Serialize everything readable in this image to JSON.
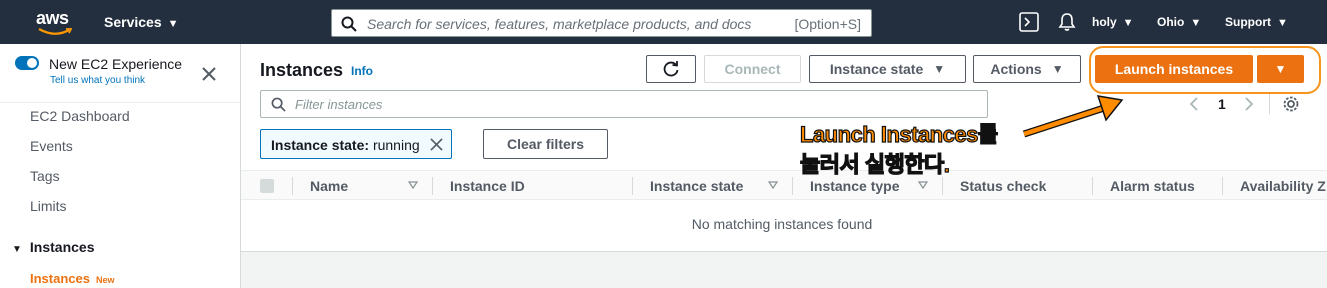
{
  "topbar": {
    "logo_text": "aws",
    "services_label": "Services",
    "search_placeholder": "Search for services, features, marketplace products, and docs",
    "search_shortcut": "[Option+S]",
    "user_label": "holy",
    "region_label": "Ohio",
    "support_label": "Support",
    "bg_color": "#232f3e"
  },
  "sidebar": {
    "experience_title": "New EC2 Experience",
    "experience_link": "Tell us what you think",
    "items": [
      {
        "label": "EC2 Dashboard"
      },
      {
        "label": "Events"
      },
      {
        "label": "Tags"
      },
      {
        "label": "Limits"
      }
    ],
    "section_label": "Instances",
    "active_item": "Instances",
    "active_badge": "New"
  },
  "main": {
    "title": "Instances",
    "info_link": "Info",
    "buttons": {
      "connect": "Connect",
      "instance_state": "Instance state",
      "actions": "Actions",
      "launch": "Launch instances"
    },
    "filter_placeholder": "Filter instances",
    "page_number": "1",
    "chip_key": "Instance state:",
    "chip_value": "running",
    "clear_filters": "Clear filters",
    "columns": [
      "Name",
      "Instance ID",
      "Instance state",
      "Instance type",
      "Status check",
      "Alarm status",
      "Availability Z"
    ],
    "empty_message": "No matching instances found",
    "accent_color": "#ec7211"
  },
  "annotation": {
    "line1": "Launch Instances를",
    "line2": "눌러서 실행한다.",
    "color": "#ff8c00"
  }
}
